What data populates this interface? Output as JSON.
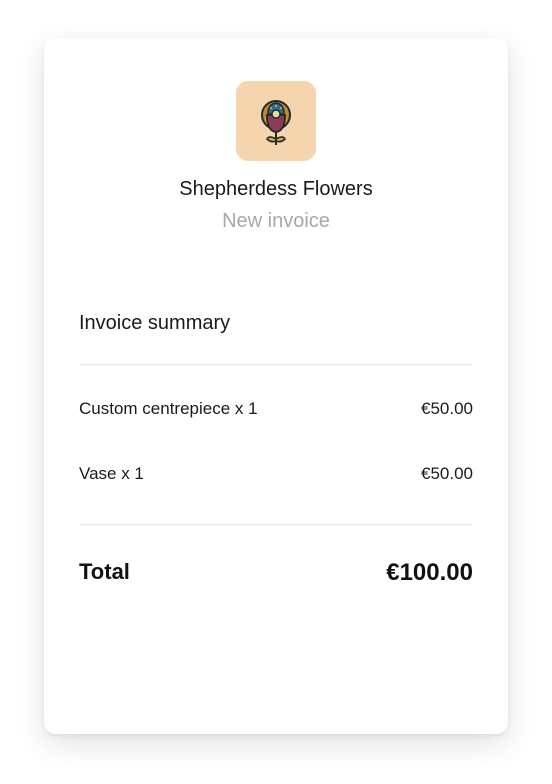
{
  "merchant": {
    "name": "Shepherdess Flowers",
    "logo_icon": "flower-logo-icon",
    "logo_bg": "#f5d5ae"
  },
  "invoice": {
    "status": "New invoice",
    "summary_title": "Invoice summary",
    "items": [
      {
        "label": "Custom centrepiece x 1",
        "amount": "€50.00"
      },
      {
        "label": "Vase x 1",
        "amount": "€50.00"
      }
    ],
    "total_label": "Total",
    "total_amount": "€100.00"
  }
}
